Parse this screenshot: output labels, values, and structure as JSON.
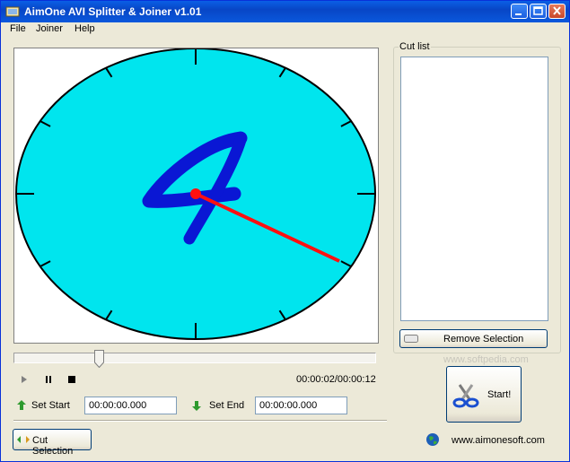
{
  "window": {
    "title": "AimOne AVI Splitter & Joiner v1.01"
  },
  "menu": {
    "file": "File",
    "joiner": "Joiner",
    "help": "Help"
  },
  "player": {
    "time": "00:00:02/00:00:12",
    "position": 0.2
  },
  "set_start": {
    "label": "Set Start",
    "value": "00:00:00.000"
  },
  "set_end": {
    "label": "Set End",
    "value": "00:00:00.000"
  },
  "buttons": {
    "cut_selection": "Cut Selection",
    "remove_selection": "Remove Selection",
    "start": "Start!"
  },
  "cut_list": {
    "title": "Cut list",
    "items": []
  },
  "footer": {
    "url": "www.aimonesoft.com",
    "watermark": "www.softpedia.com"
  },
  "colors": {
    "clock_face": "#00e5ee",
    "digit": "#0a17d4",
    "hand": "#ff1010",
    "title_bar": "#0a5fe6"
  },
  "icons": [
    "app-icon",
    "minimize-icon",
    "maximize-icon",
    "close-icon",
    "play-icon",
    "pause-icon",
    "stop-icon",
    "up-arrow-icon",
    "down-arrow-icon",
    "scissors-icon",
    "globe-icon"
  ]
}
